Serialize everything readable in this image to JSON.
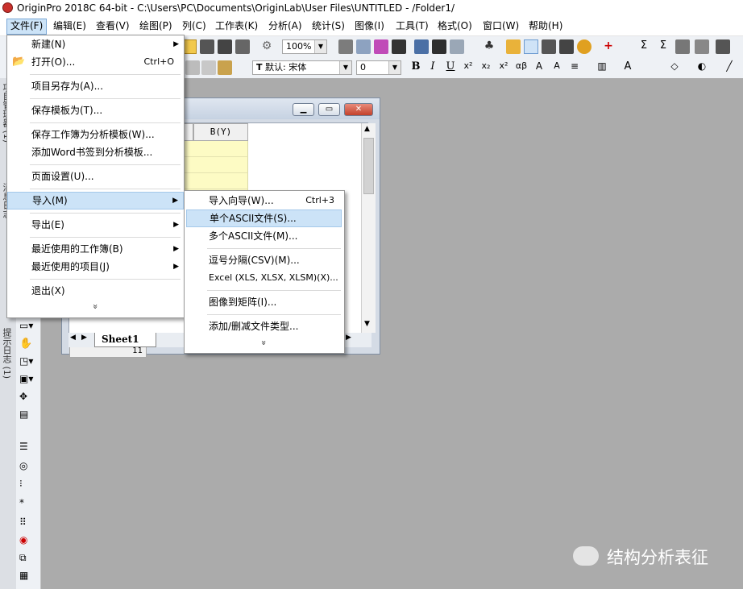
{
  "titlebar": {
    "title": "OriginPro 2018C 64-bit - C:\\Users\\PC\\Documents\\OriginLab\\User Files\\UNTITLED - /Folder1/"
  },
  "menubar": [
    "文件(F)",
    "编辑(E)",
    "查看(V)",
    "绘图(P)",
    "列(C)",
    "工作表(K)",
    "分析(A)",
    "统计(S)",
    "图像(I)",
    "工具(T)",
    "格式(O)",
    "窗口(W)",
    "帮助(H)"
  ],
  "toolbar": {
    "zoom": "100%",
    "font_name": "默认: 宋体",
    "font_size": "0"
  },
  "left_dock": {
    "tabs": [
      "项目管理器 (1)",
      "消息日志",
      "提示日志 (1)"
    ]
  },
  "workbook": {
    "column_b": "B(Y)",
    "row_11": "11",
    "sheet_tab": "Sheet1"
  },
  "file_menu": {
    "items": [
      {
        "label": "新建(N)",
        "shortcut": "",
        "submenu": true
      },
      {
        "label": "打开(O)...",
        "shortcut": "Ctrl+O",
        "submenu": false
      },
      {
        "label": "项目另存为(A)...",
        "shortcut": "",
        "submenu": false
      },
      {
        "label": "保存模板为(T)...",
        "shortcut": "",
        "submenu": false
      },
      {
        "label": "保存工作簿为分析模板(W)...",
        "shortcut": "",
        "submenu": false
      },
      {
        "label": "添加Word书签到分析模板...",
        "shortcut": "",
        "submenu": false
      },
      {
        "label": "页面设置(U)...",
        "shortcut": "",
        "submenu": false
      },
      {
        "label": "导入(M)",
        "shortcut": "",
        "submenu": true
      },
      {
        "label": "导出(E)",
        "shortcut": "",
        "submenu": true
      },
      {
        "label": "最近使用的工作簿(B)",
        "shortcut": "",
        "submenu": true
      },
      {
        "label": "最近使用的项目(J)",
        "shortcut": "",
        "submenu": true
      },
      {
        "label": "退出(X)",
        "shortcut": "",
        "submenu": false
      }
    ],
    "more": "»"
  },
  "import_menu": {
    "items": [
      {
        "label": "导入向导(W)...",
        "shortcut": "Ctrl+3"
      },
      {
        "label": "单个ASCII文件(S)...",
        "shortcut": ""
      },
      {
        "label": "多个ASCII文件(M)...",
        "shortcut": ""
      },
      {
        "label": "逗号分隔(CSV)(M)...",
        "shortcut": ""
      },
      {
        "label": "Excel (XLS, XLSX, XLSM)(X)...",
        "shortcut": ""
      },
      {
        "label": "图像到矩阵(I)...",
        "shortcut": ""
      },
      {
        "label": "添加/删减文件类型...",
        "shortcut": ""
      }
    ],
    "more": "»"
  },
  "watermark": {
    "text": "结构分析表征"
  }
}
